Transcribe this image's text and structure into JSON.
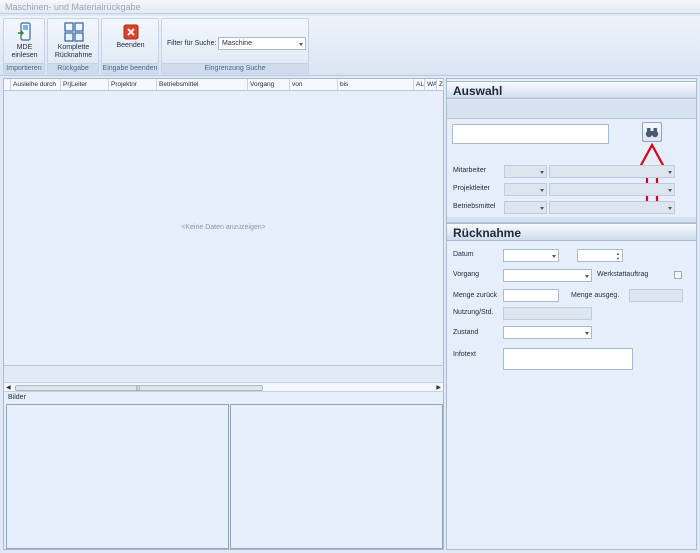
{
  "window": {
    "title": "Maschinen- und Materialrückgabe"
  },
  "ribbon": {
    "importieren": {
      "button_label": "MDE einlesen",
      "group_label": "Importieren"
    },
    "rueckgabe": {
      "button_label": "Komplette Rücknahme",
      "group_label": "Rückgabe"
    },
    "eingabe": {
      "button_label": "Beenden",
      "group_label": "Eingabe beenden"
    },
    "suche": {
      "filter_label": "Filter für Suche:",
      "filter_value": "Maschine",
      "group_label": "Eingrenzung Suche"
    }
  },
  "grid": {
    "columns": [
      "Ausleihe durch",
      "PrjLeiter",
      "Projektnr",
      "Betriebsmittel",
      "Vorgang",
      "von",
      "bis",
      "AL",
      "WA",
      "Z"
    ],
    "empty_text": "<Keine Daten anzuzeigen>"
  },
  "bilder": {
    "label": "Bilder"
  },
  "auswahl": {
    "title": "Auswahl",
    "search_value": "",
    "labels": {
      "mitarbeiter": "Mitarbeiter",
      "projektleiter": "Projektleiter",
      "betriebsmittel": "Betriebsmittel"
    }
  },
  "ruecknahme": {
    "title": "Rücknahme",
    "labels": {
      "datum": "Datum",
      "vorgang": "Vorgang",
      "werkstattauftrag": "Werkstattauftrag",
      "menge_zurueck": "Menge zurück",
      "menge_ausgeg": "Menge ausgeg.",
      "nutzung": "Nutzung/Std.",
      "zustand": "Zustand",
      "infotext": "Infotext"
    }
  },
  "colors": {
    "annotation_arrow": "#d9001b",
    "accent": "#2f5d9a"
  },
  "icons": {
    "mde": "handheld-import-icon",
    "rueckgabe": "grid-four-icon",
    "beenden": "red-close-icon",
    "search": "binoculars-icon"
  }
}
